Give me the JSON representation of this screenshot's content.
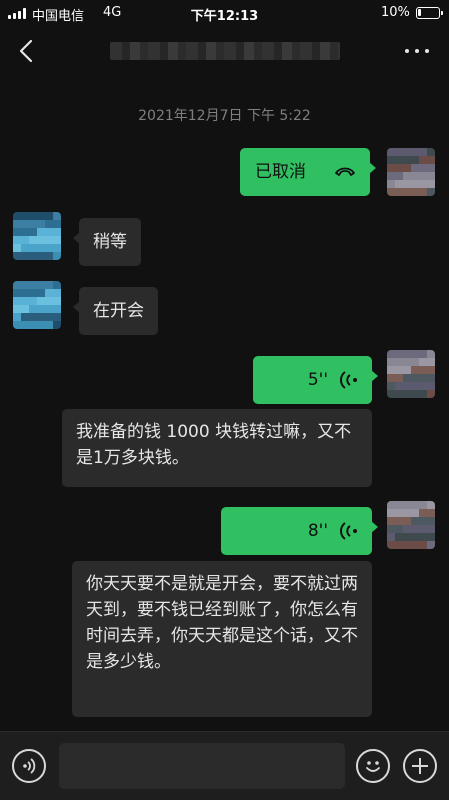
{
  "status_bar": {
    "carrier": "中国电信",
    "network": "4G",
    "time": "下午12:13",
    "battery": "10%",
    "battery_level": 0.1
  },
  "nav": {
    "back_icon": "chevron-left-icon",
    "more_icon": "more-dots-icon"
  },
  "chat": {
    "timestamp": "2021年12月7日 下午 5:22",
    "call_message": {
      "text": "已取消",
      "icon": "hang-up-phone-icon"
    },
    "messages": [
      {
        "side": "left",
        "text": "稍等"
      },
      {
        "side": "left",
        "text": "在开会"
      }
    ],
    "voice_messages": [
      {
        "duration": "5''",
        "transcript": "我准备的钱 1000 块钱转过嘛，又不是1万多块钱。"
      },
      {
        "duration": "8''",
        "transcript": "你天天要不是就是开会，要不就过两天到，要不钱已经到账了，你怎么有时间去弄，你天天都是这个话，又不是多少钱。"
      }
    ]
  },
  "input_bar": {
    "placeholder": "",
    "voice_icon": "voice-input-icon",
    "emoji_icon": "emoji-icon",
    "plus_icon": "plus-icon"
  },
  "colors": {
    "background": "#111111",
    "bubble_green": "#31c061",
    "bubble_gray": "#2b2b2b",
    "timestamp": "#7f7f7f"
  }
}
